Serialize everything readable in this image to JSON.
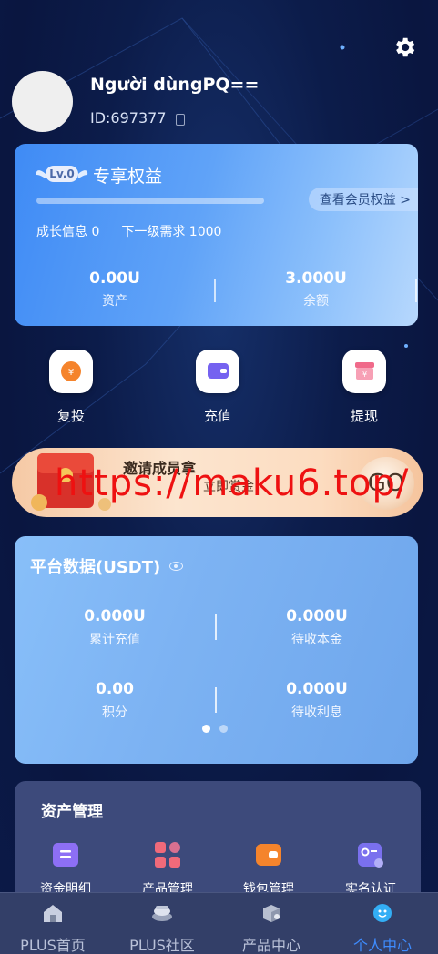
{
  "header": {
    "username": "Người dùngPQ==",
    "user_id": "ID:697377"
  },
  "vip": {
    "level": "Lv.0",
    "title": "专享权益",
    "view_benefits": "查看会员权益 >",
    "growth_info": "成长信息 0",
    "next_level": "下一级需求 1000",
    "progress": 0,
    "assets_value": "0.00U",
    "assets_label": "资产",
    "balance_value": "3.000U",
    "balance_label": "余额"
  },
  "actions": [
    {
      "label": "复投",
      "icon": "yen-coin-icon",
      "color": "#f5842c"
    },
    {
      "label": "充值",
      "icon": "wallet-icon",
      "color": "#7562f0"
    },
    {
      "label": "提现",
      "icon": "gift-box-icon",
      "color": "#f06a8a"
    }
  ],
  "invite": {
    "title": "邀请成员拿",
    "subtitle": "立即赏金",
    "go_label": "GO",
    "watermark": "https://maku6.top/"
  },
  "platform": {
    "title": "平台数据(USDT)",
    "stats": [
      {
        "value": "0.000U",
        "label": "累计充值"
      },
      {
        "value": "0.000U",
        "label": "待收本金"
      },
      {
        "value": "0.00",
        "label": "积分"
      },
      {
        "value": "0.000U",
        "label": "待收利息"
      }
    ]
  },
  "assets": {
    "title": "资产管理",
    "items": [
      {
        "label": "资金明细",
        "icon": "ledger-icon"
      },
      {
        "label": "产品管理",
        "icon": "grid-apps-icon"
      },
      {
        "label": "钱包管理",
        "icon": "wallet-icon"
      },
      {
        "label": "实名认证",
        "icon": "id-card-icon"
      }
    ]
  },
  "tabbar": {
    "tabs": [
      {
        "label": "PLUS首页",
        "icon": "home-icon",
        "active": false
      },
      {
        "label": "PLUS社区",
        "icon": "community-icon",
        "active": false
      },
      {
        "label": "产品中心",
        "icon": "product-box-icon",
        "active": false
      },
      {
        "label": "个人中心",
        "icon": "profile-icon",
        "active": true
      }
    ]
  },
  "colors": {
    "accent": "#3e8cff",
    "background": "#0c1c4a"
  }
}
